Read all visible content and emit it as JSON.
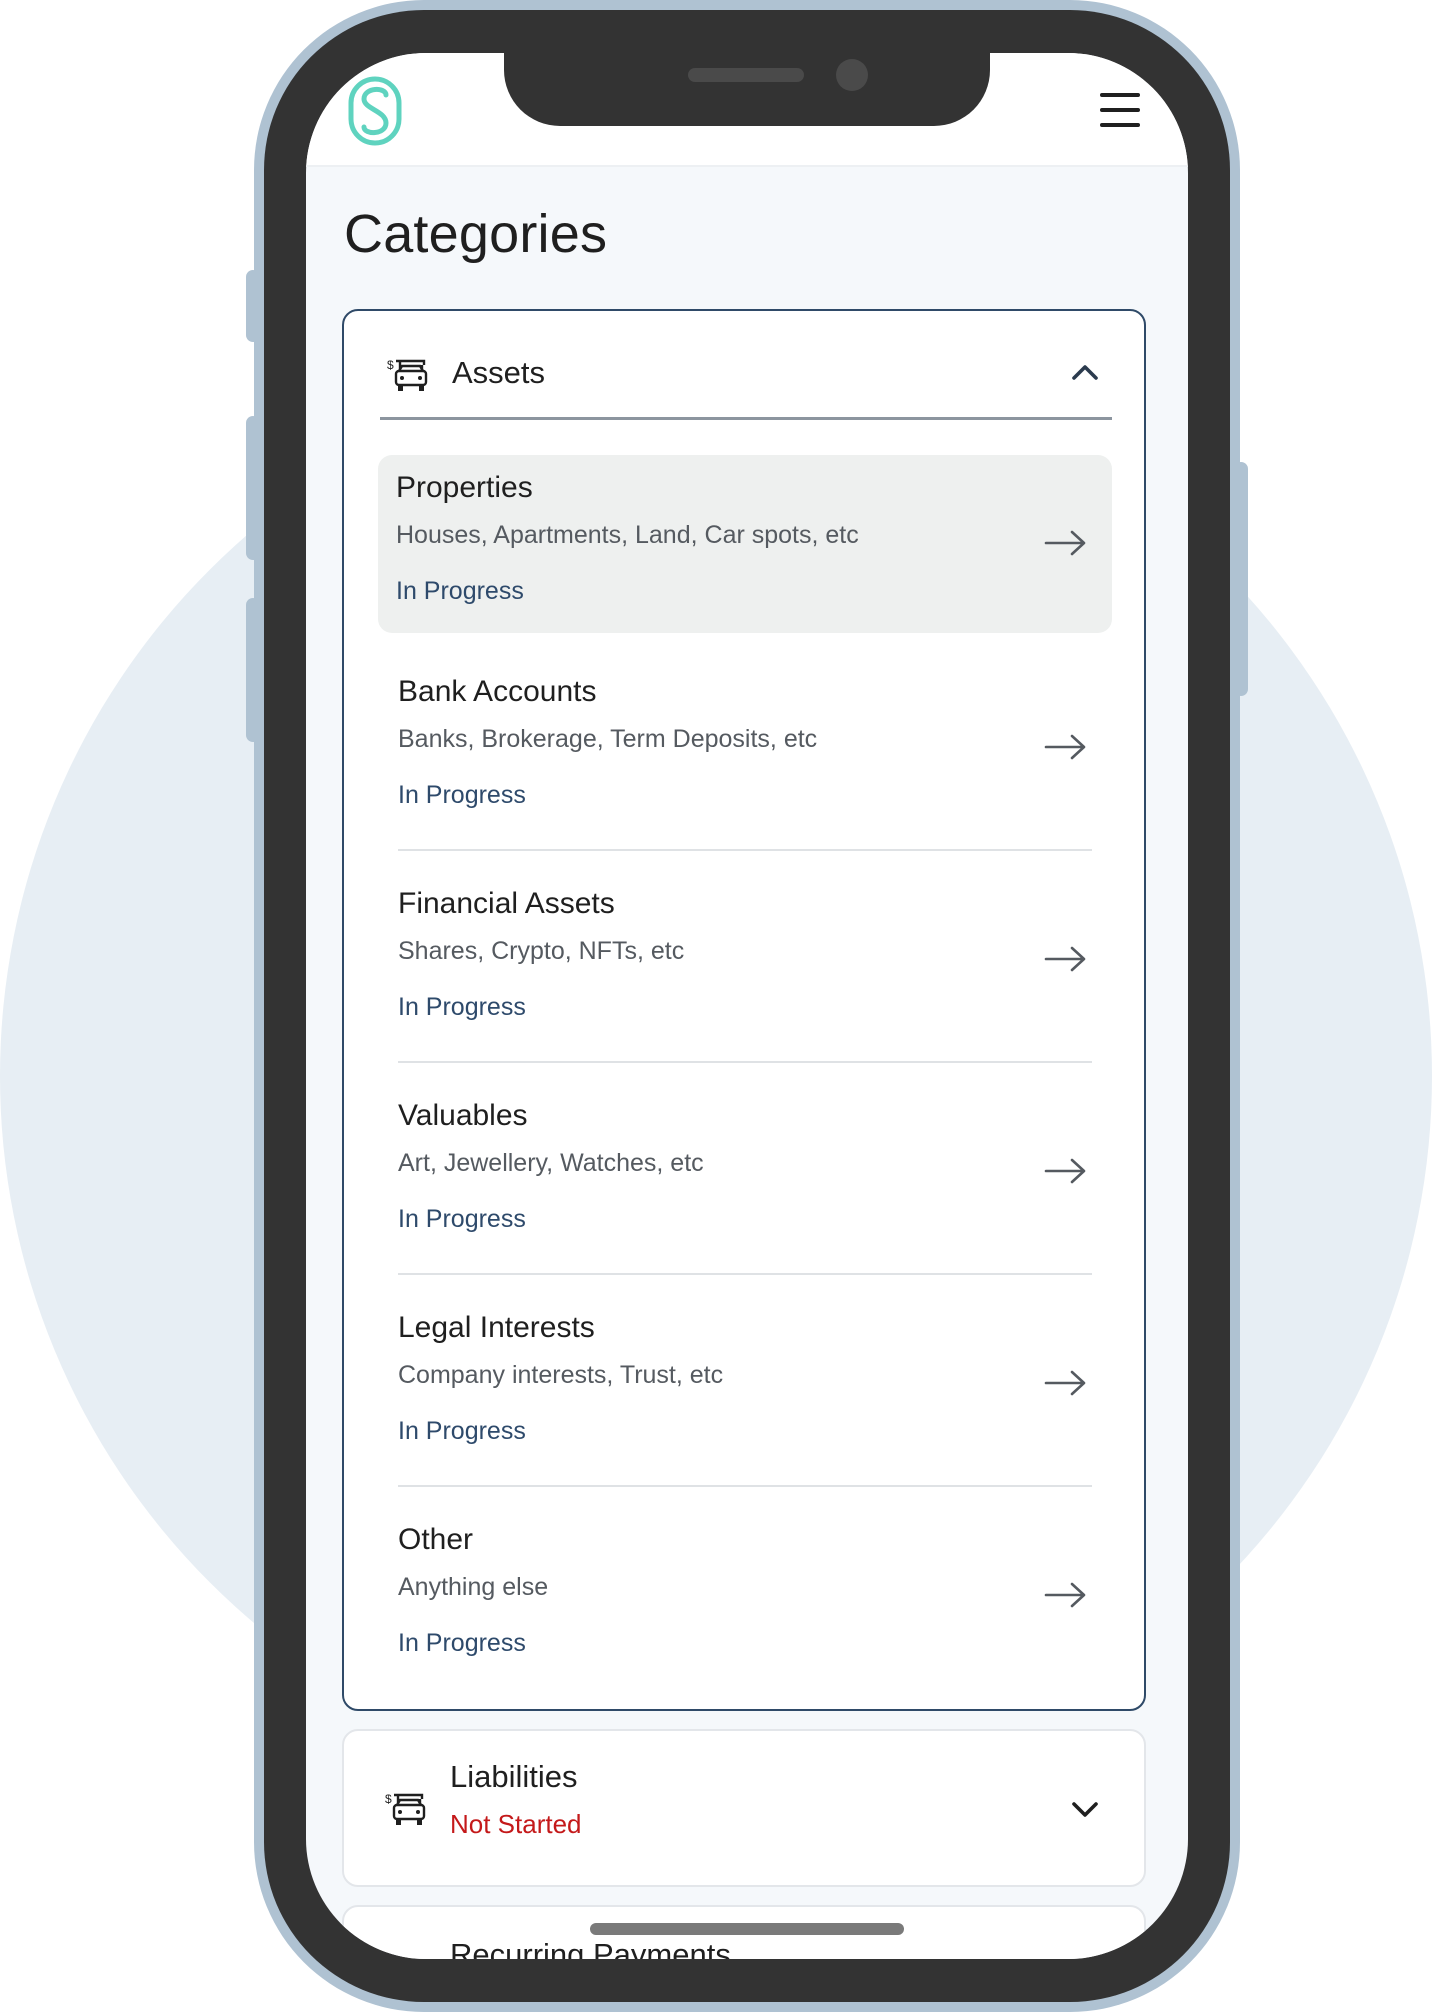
{
  "app": {
    "brand_color": "#5fd3bf",
    "accent_navy": "#2e4a6b",
    "not_started_color": "#c4191a"
  },
  "header": {
    "logo_icon": "s-chain-logo-icon",
    "menu_icon": "hamburger-menu-icon"
  },
  "page": {
    "title": "Categories"
  },
  "assets": {
    "title": "Assets",
    "icon": "car-dollar-icon",
    "expanded": true,
    "items": [
      {
        "title": "Properties",
        "description": "Houses, Apartments, Land, Car spots, etc",
        "status": "In Progress"
      },
      {
        "title": "Bank Accounts",
        "description": "Banks, Brokerage, Term Deposits, etc",
        "status": "In Progress"
      },
      {
        "title": "Financial Assets",
        "description": "Shares, Crypto, NFTs, etc",
        "status": "In Progress"
      },
      {
        "title": "Valuables",
        "description": "Art, Jewellery, Watches, etc",
        "status": "In Progress"
      },
      {
        "title": "Legal Interests",
        "description": "Company interests, Trust, etc",
        "status": "In Progress"
      },
      {
        "title": "Other",
        "description": "Anything else",
        "status": "In Progress"
      }
    ]
  },
  "liabilities": {
    "title": "Liabilities",
    "status": "Not Started",
    "icon": "car-dollar-icon",
    "expanded": false
  },
  "recurring": {
    "title": "Recurring Payments"
  }
}
